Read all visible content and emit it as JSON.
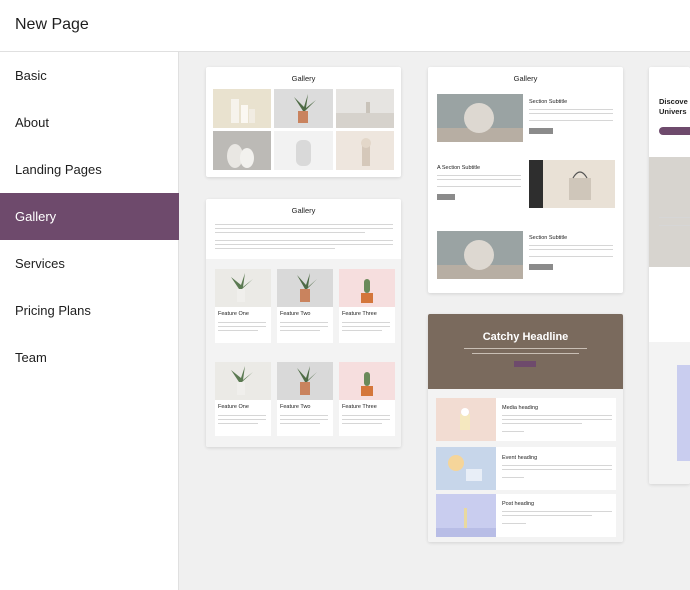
{
  "header": {
    "title": "New Page"
  },
  "sidebar": {
    "items": [
      {
        "label": "Basic"
      },
      {
        "label": "About"
      },
      {
        "label": "Landing Pages"
      },
      {
        "label": "Gallery",
        "active": true
      },
      {
        "label": "Services"
      },
      {
        "label": "Pricing Plans"
      },
      {
        "label": "Team"
      }
    ]
  },
  "previews": {
    "gallery1": {
      "title": "Gallery"
    },
    "gallery2": {
      "title": "Gallery",
      "features": [
        "Feature One",
        "Feature Two",
        "Feature Three",
        "Feature One",
        "Feature Two",
        "Feature Three"
      ]
    },
    "gallery3": {
      "title": "Gallery",
      "section1": "Section Subtitle",
      "section2": "A Section Subtitle",
      "section3": "Section Subtitle"
    },
    "catchy": {
      "headline": "Catchy Headline",
      "items": [
        "Media heading",
        "Event heading",
        "Post heading"
      ]
    },
    "partial": {
      "headline_line1": "Discove",
      "headline_line2": "Univers"
    }
  },
  "colors": {
    "accent": "#6e4a6c",
    "background": "#f0f0f0",
    "headerBrown": "#7a6a5d"
  }
}
